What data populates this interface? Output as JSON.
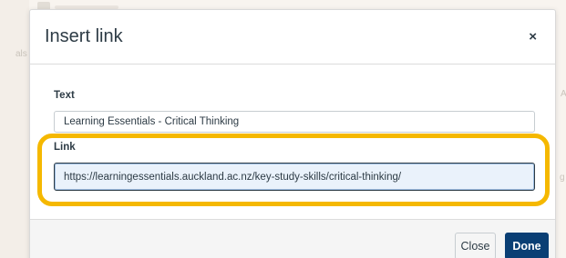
{
  "background": {
    "left_fragment": "als",
    "right_fragment_1": "A",
    "right_fragment_2": "g"
  },
  "dialog": {
    "title": "Insert link",
    "close_icon": "close-icon",
    "close_glyph": "×",
    "text_field": {
      "label": "Text",
      "value": "Learning Essentials - Critical Thinking"
    },
    "link_field": {
      "label": "Link",
      "value": "https://learningessentials.auckland.ac.nz/key-study-skills/critical-thinking/"
    },
    "buttons": {
      "close_label": "Close",
      "done_label": "Done"
    }
  },
  "colors": {
    "highlight": "#f5b800",
    "primary_button": "#0a3f74",
    "text": "#2d3b45"
  }
}
